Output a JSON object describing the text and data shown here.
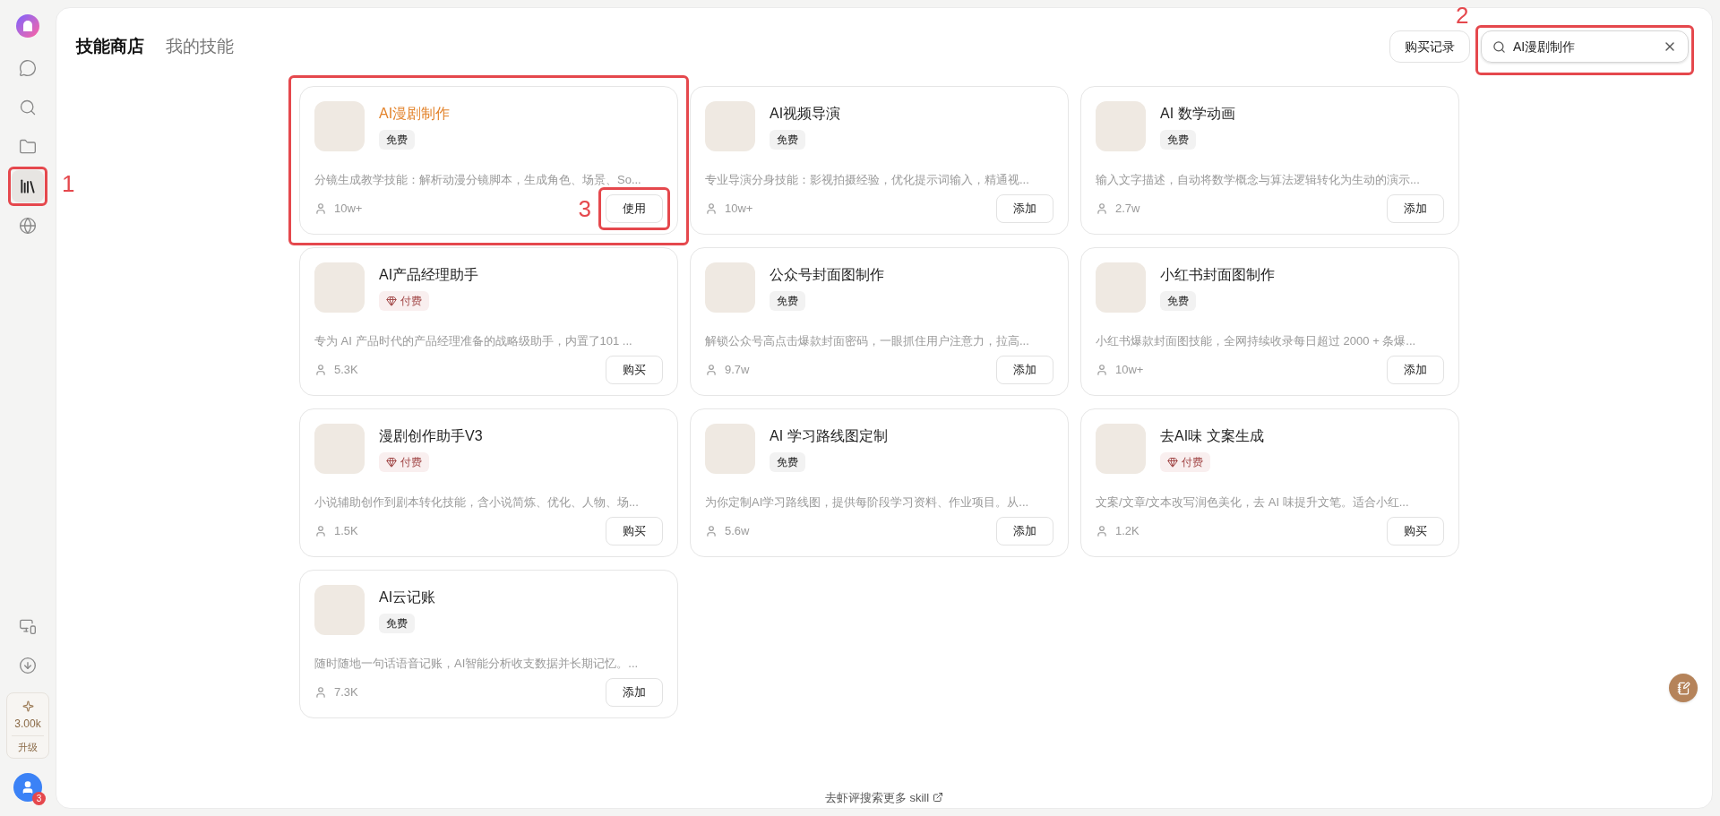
{
  "sidebar": {
    "nav_items": [
      {
        "kind": "chat",
        "selected": false
      },
      {
        "kind": "search",
        "selected": false
      },
      {
        "kind": "folder",
        "selected": false
      },
      {
        "kind": "library",
        "selected": true,
        "annotation": "1"
      },
      {
        "kind": "globe",
        "selected": false
      }
    ],
    "bottom_items": [
      {
        "kind": "devices"
      },
      {
        "kind": "download"
      }
    ],
    "credits": {
      "value": "3.00k",
      "action": "升级"
    },
    "avatar": {
      "badge": "3"
    }
  },
  "header": {
    "tabs": [
      {
        "label": "技能商店",
        "selected": true
      },
      {
        "label": "我的技能",
        "selected": false
      }
    ],
    "purchase_button": "购买记录",
    "search": {
      "value": "AI漫剧制作",
      "annotation": "2"
    }
  },
  "cards": [
    {
      "title": "AI漫剧制作",
      "highlighted": true,
      "badge": {
        "kind": "free",
        "label": "免费"
      },
      "description": "分镜生成教学技能：解析动漫分镜脚本，生成角色、场景、So...",
      "users": "10w+",
      "action": "使用",
      "annotation": "3"
    },
    {
      "title": "AI视频导演",
      "highlighted": false,
      "badge": {
        "kind": "free",
        "label": "免费"
      },
      "description": "专业导演分身技能：影视拍摄经验，优化提示词输入，精通视...",
      "users": "10w+",
      "action": "添加"
    },
    {
      "title": "AI 数学动画",
      "highlighted": false,
      "badge": {
        "kind": "free",
        "label": "免费"
      },
      "description": "输入文字描述，自动将数学概念与算法逻辑转化为生动的演示...",
      "users": "2.7w",
      "action": "添加"
    },
    {
      "title": "AI产品经理助手",
      "highlighted": false,
      "badge": {
        "kind": "paid",
        "label": "付费"
      },
      "description": "专为 AI 产品时代的产品经理准备的战略级助手，内置了101 ...",
      "users": "5.3K",
      "action": "购买"
    },
    {
      "title": "公众号封面图制作",
      "highlighted": false,
      "badge": {
        "kind": "free",
        "label": "免费"
      },
      "description": "解锁公众号高点击爆款封面密码，一眼抓住用户注意力，拉高...",
      "users": "9.7w",
      "action": "添加"
    },
    {
      "title": "小红书封面图制作",
      "highlighted": false,
      "badge": {
        "kind": "free",
        "label": "免费"
      },
      "description": "小红书爆款封面图技能，全网持续收录每日超过 2000 + 条爆...",
      "users": "10w+",
      "action": "添加"
    },
    {
      "title": "漫剧创作助手V3",
      "highlighted": false,
      "badge": {
        "kind": "paid",
        "label": "付费"
      },
      "description": "小说辅助创作到剧本转化技能，含小说简炼、优化、人物、场...",
      "users": "1.5K",
      "action": "购买"
    },
    {
      "title": "AI 学习路线图定制",
      "highlighted": false,
      "badge": {
        "kind": "free",
        "label": "免费"
      },
      "description": "为你定制AI学习路线图，提供每阶段学习资料、作业项目。从...",
      "users": "5.6w",
      "action": "添加"
    },
    {
      "title": "去AI味 文案生成",
      "highlighted": false,
      "badge": {
        "kind": "paid",
        "label": "付费"
      },
      "description": "文案/文章/文本改写润色美化，去 AI 味提升文笔。适合小红...",
      "users": "1.2K",
      "action": "购买"
    },
    {
      "title": "AI云记账",
      "highlighted": false,
      "badge": {
        "kind": "free",
        "label": "免费"
      },
      "description": "随时随地一句话语音记账，AI智能分析收支数据并长期记忆。...",
      "users": "7.3K",
      "action": "添加"
    }
  ],
  "footer_link": "去虾评搜索更多 skill"
}
